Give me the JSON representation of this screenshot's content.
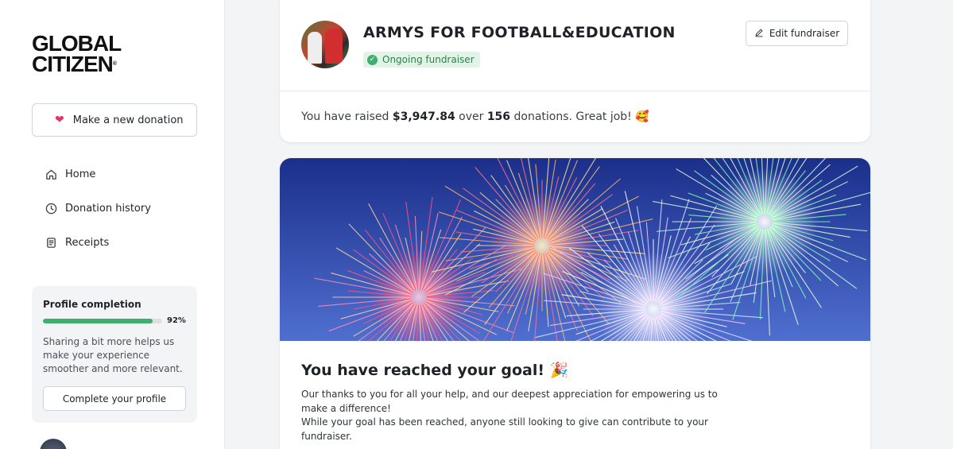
{
  "brand": {
    "logo_line1": "GLOBAL",
    "logo_line2": "CITIZEN",
    "logo_mark": "®"
  },
  "sidebar": {
    "donate_button": {
      "label": "Make a new donation",
      "icon": "heart-icon"
    },
    "nav": [
      {
        "label": "Home",
        "icon": "home-icon"
      },
      {
        "label": "Donation history",
        "icon": "clock-icon"
      },
      {
        "label": "Receipts",
        "icon": "receipt-icon"
      }
    ],
    "profile": {
      "title": "Profile completion",
      "percent": 92,
      "percent_label": "92%",
      "description": "Sharing a bit more helps us make your experience smoother and more relevant.",
      "button_label": "Complete your profile"
    }
  },
  "fundraiser": {
    "title": "ARMYS FOR FOOTBALL&EDUCATION",
    "status": "Ongoing fundraiser",
    "edit_label": "Edit fundraiser",
    "raised_prefix": "You have raised ",
    "amount": "$3,947.84",
    "raised_mid": " over ",
    "donation_count": "156",
    "raised_suffix": " donations. Great job! 🥰"
  },
  "goal": {
    "title": "You have reached your goal! 🎉",
    "line1": "Our thanks to you for all your help, and our deepest appreciation for empowering us to make a difference!",
    "line2": "While your goal has been reached, anyone still looking to give can contribute to your fundraiser."
  },
  "colors": {
    "accent_green": "#3fae6f",
    "heart_pink": "#e6336b",
    "badge_bg": "#e2f4e8",
    "sky_top": "#1b2f8a",
    "sky_bottom": "#4f6fd0"
  }
}
